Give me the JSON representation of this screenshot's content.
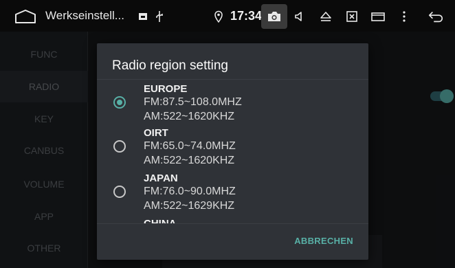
{
  "statusbar": {
    "title": "Werkseinstell...",
    "time": "17:34",
    "icons": [
      "home-icon",
      "media-icon",
      "usb-icon",
      "location-icon",
      "camera-icon",
      "volume-icon",
      "eject-icon",
      "close-window-icon",
      "window-icon",
      "more-icon",
      "back-icon"
    ]
  },
  "sidebar": {
    "items": [
      {
        "label": "FUNC"
      },
      {
        "label": "RADIO"
      },
      {
        "label": "KEY"
      },
      {
        "label": "CANBUS"
      },
      {
        "label": "VOLUME"
      },
      {
        "label": "APP"
      },
      {
        "label": "OTHER"
      }
    ],
    "active": "RADIO"
  },
  "dialog": {
    "title": "Radio region setting",
    "options": [
      {
        "name": "EUROPE",
        "fm": "FM:87.5~108.0MHZ",
        "am": "AM:522~1620KHZ",
        "selected": true
      },
      {
        "name": "OIRT",
        "fm": "FM:65.0~74.0MHZ",
        "am": "AM:522~1620KHZ",
        "selected": false
      },
      {
        "name": "JAPAN",
        "fm": "FM:76.0~90.0MHZ",
        "am": "AM:522~1629KHZ",
        "selected": false
      },
      {
        "name": "CHINA",
        "fm": "",
        "am": "",
        "selected": false
      }
    ],
    "button": "ABBRECHEN"
  },
  "colors": {
    "accent": "#58b0a6",
    "dialog_bg": "#2f3237",
    "statusbar_bg": "#0a0a0a"
  }
}
